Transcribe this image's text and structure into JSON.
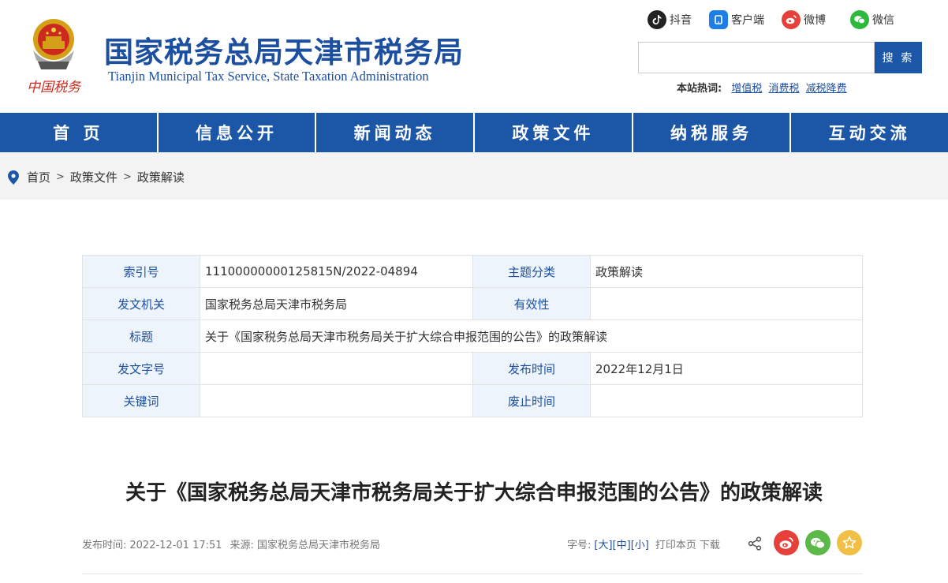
{
  "header": {
    "title": "国家税务总局天津市税务局",
    "subtitle": "Tianjin Municipal Tax Service, State Taxation Administration",
    "logo_text": "中国税务"
  },
  "social": {
    "douyin": "抖音",
    "client": "客户端",
    "weibo": "微博",
    "wechat": "微信"
  },
  "search": {
    "placeholder": "",
    "button": "搜 索",
    "hot_label": "本站热词:",
    "hot_words": [
      "增值税",
      "消费税",
      "减税降费"
    ]
  },
  "nav": [
    "首 页",
    "信息公开",
    "新闻动态",
    "政策文件",
    "纳税服务",
    "互动交流"
  ],
  "breadcrumb": [
    "首页",
    "政策文件",
    "政策解读"
  ],
  "info": {
    "index_label": "索引号",
    "index_value": "11100000000125815N/2022-04894",
    "category_label": "主题分类",
    "category_value": "政策解读",
    "issuer_label": "发文机关",
    "issuer_value": "国家税务总局天津市税务局",
    "validity_label": "有效性",
    "validity_value": "",
    "title_label": "标题",
    "title_value": "关于《国家税务总局天津市税务局关于扩大综合申报范围的公告》的政策解读",
    "docno_label": "发文字号",
    "docno_value": "",
    "pubtime_label": "发布时间",
    "pubtime_value": "2022年12月1日",
    "keyword_label": "关键词",
    "keyword_value": "",
    "expire_label": "废止时间",
    "expire_value": ""
  },
  "article": {
    "title": "关于《国家税务总局天津市税务局关于扩大综合申报范围的公告》的政策解读",
    "publish_label": "发布时间:",
    "publish_time": "2022-12-01 17:51",
    "source_label": "来源:",
    "source": "国家税务总局天津市税务局"
  },
  "tools": {
    "font_label": "字号:",
    "large": "[大]",
    "medium": "[中]",
    "small": "[小]",
    "print": "打印本页",
    "download": "下载"
  },
  "colors": {
    "primary": "#1c57a7",
    "title_blue": "#1c4fa0",
    "weibo_red": "#e6403a",
    "wechat_green": "#5bb948",
    "star_yellow": "#f1bf46"
  }
}
